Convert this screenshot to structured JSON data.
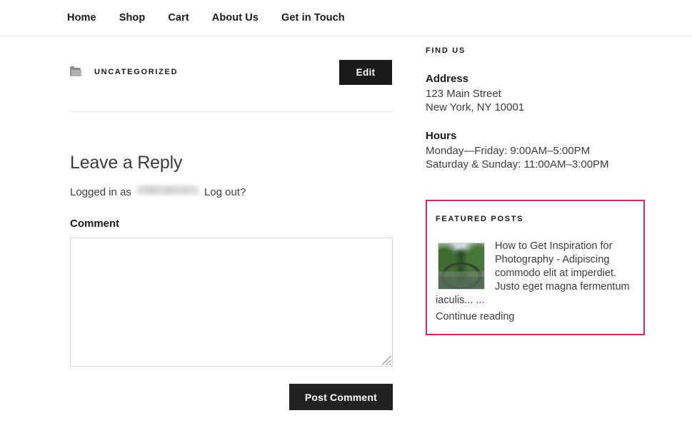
{
  "nav": {
    "items": [
      {
        "label": "Home"
      },
      {
        "label": "Shop"
      },
      {
        "label": "Cart"
      },
      {
        "label": "About Us"
      },
      {
        "label": "Get in Touch"
      }
    ]
  },
  "entry": {
    "category_icon": "folder-icon",
    "category": "UNCATEGORIZED",
    "edit_label": "Edit"
  },
  "comments": {
    "reply_title": "Leave a Reply",
    "logged_in_prefix": "Logged in as",
    "username_redacted": "",
    "logout_label": "Log out?",
    "comment_label": "Comment",
    "comment_value": "",
    "comment_placeholder": "",
    "submit_label": "Post Comment"
  },
  "sidebar": {
    "find_us": {
      "title": "FIND US",
      "address_heading": "Address",
      "address_line1": "123 Main Street",
      "address_line2": "New York, NY 10001",
      "hours_heading": "Hours",
      "hours_line1": "Monday—Friday: 9:00AM–5:00PM",
      "hours_line2": "Saturday & Sunday: 11:00AM–3:00PM"
    },
    "featured": {
      "title": "FEATURED POSTS",
      "border_color": "#e0264f",
      "post": {
        "thumbnail_name": "bridge-over-river-photo",
        "excerpt": "How to Get Inspiration for Photography - Adipiscing commodo elit at imperdiet. Justo eget magna fermentum iaculis... ...",
        "continue_label": "Continue reading"
      }
    }
  }
}
